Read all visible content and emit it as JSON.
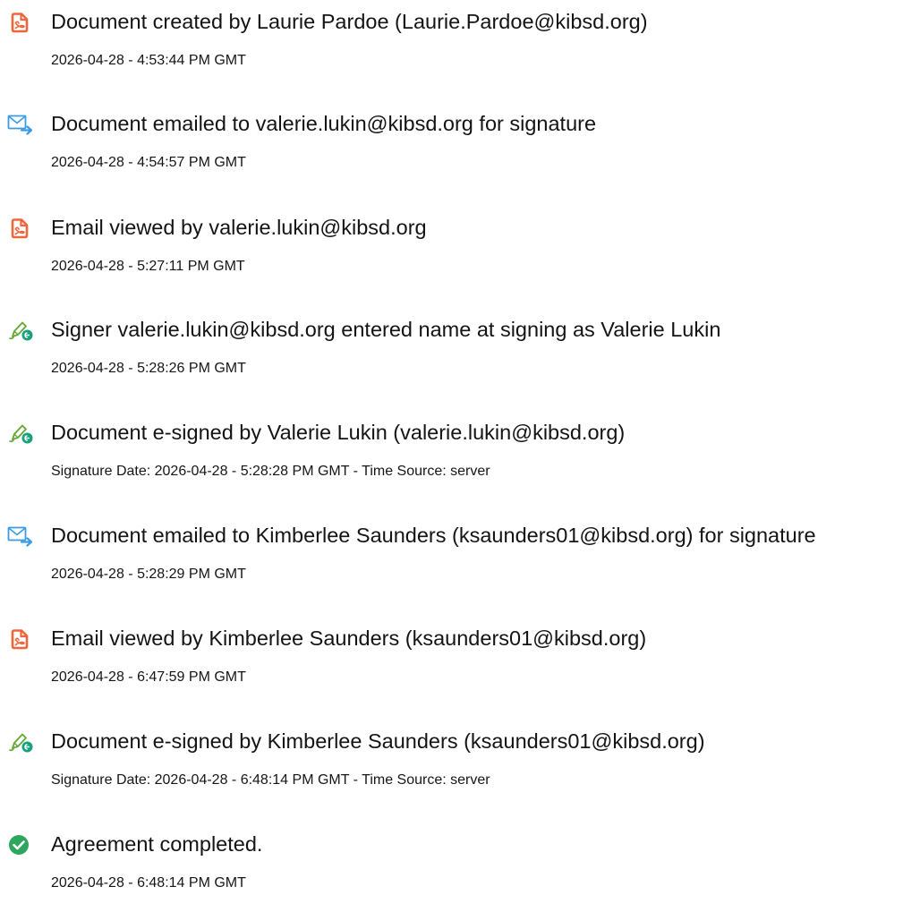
{
  "colors": {
    "document_icon": "#f0653a",
    "email_icon": "#3b9be4",
    "sign_pen": "#67a938",
    "sign_badge": "#17a27c",
    "completed_badge": "#2ea65f",
    "text": "#141414"
  },
  "events": [
    {
      "icon": "document-icon",
      "title": "Document created by Laurie Pardoe (Laurie.Pardoe@kibsd.org)",
      "meta": "2026-04-28 - 4:53:44 PM GMT"
    },
    {
      "icon": "email-icon",
      "title": "Document emailed to valerie.lukin@kibsd.org for signature",
      "meta": "2026-04-28 - 4:54:57 PM GMT"
    },
    {
      "icon": "document-icon",
      "title": "Email viewed by valerie.lukin@kibsd.org",
      "meta": "2026-04-28 - 5:27:11 PM GMT"
    },
    {
      "icon": "signature-pen-icon",
      "title": "Signer valerie.lukin@kibsd.org entered name at signing as Valerie Lukin",
      "meta": "2026-04-28 - 5:28:26 PM GMT"
    },
    {
      "icon": "signature-pen-icon",
      "title": "Document e-signed by Valerie Lukin (valerie.lukin@kibsd.org)",
      "meta": "Signature Date: 2026-04-28 - 5:28:28 PM GMT - Time Source: server"
    },
    {
      "icon": "email-icon",
      "title": "Document emailed to Kimberlee Saunders (ksaunders01@kibsd.org) for signature",
      "meta": "2026-04-28 - 5:28:29 PM GMT"
    },
    {
      "icon": "document-icon",
      "title": "Email viewed by Kimberlee Saunders (ksaunders01@kibsd.org)",
      "meta": "2026-04-28 - 6:47:59 PM GMT"
    },
    {
      "icon": "signature-pen-icon",
      "title": "Document e-signed by Kimberlee Saunders (ksaunders01@kibsd.org)",
      "meta": "Signature Date: 2026-04-28 - 6:48:14 PM GMT - Time Source: server"
    },
    {
      "icon": "check-circle-icon",
      "title": "Agreement completed.",
      "meta": "2026-04-28 - 6:48:14 PM GMT"
    }
  ]
}
